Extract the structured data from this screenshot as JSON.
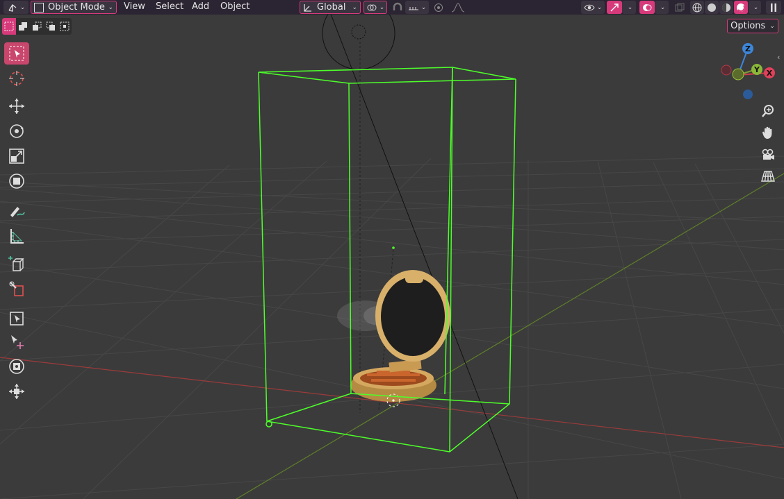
{
  "header": {
    "editor_type_icon": "3d-viewport-icon",
    "mode_label": "Object Mode",
    "menus": [
      "View",
      "Select",
      "Add",
      "Object"
    ],
    "transform_orientation": "Global"
  },
  "viewport": {
    "options_label": "Options",
    "gizmo_labels": {
      "z": "Z",
      "y": "Y",
      "x": "X"
    }
  },
  "toolbar": {
    "tools": [
      {
        "name": "select-box-tool",
        "icon": "select-box-icon",
        "active": true
      },
      {
        "name": "cursor-tool",
        "icon": "cursor-icon"
      },
      {
        "name": "move-tool",
        "icon": "move-icon"
      },
      {
        "name": "rotate-tool",
        "icon": "rotate-icon"
      },
      {
        "name": "scale-tool",
        "icon": "scale-icon"
      },
      {
        "name": "transform-tool",
        "icon": "transform-icon"
      },
      {
        "name": "annotate-tool",
        "icon": "annotate-icon"
      },
      {
        "name": "measure-tool",
        "icon": "measure-icon"
      },
      {
        "name": "add-cube-tool",
        "icon": "add-cube-icon"
      },
      {
        "name": "extra-tool-1",
        "icon": "shear-icon"
      },
      {
        "name": "extra-tool-2",
        "icon": "select-frame-icon"
      },
      {
        "name": "extra-tool-3",
        "icon": "move-cursor-icon"
      },
      {
        "name": "extra-tool-4",
        "icon": "transform-circle-icon"
      },
      {
        "name": "extra-tool-5",
        "icon": "move-arrows-icon"
      }
    ]
  },
  "colors": {
    "accent": "#d63a7a",
    "header_bg": "#2b2432",
    "viewport_bg": "#3b3b3b",
    "selection_outline": "#4dff2a",
    "x_axis": "#c44848",
    "y_axis": "#7ba035"
  }
}
